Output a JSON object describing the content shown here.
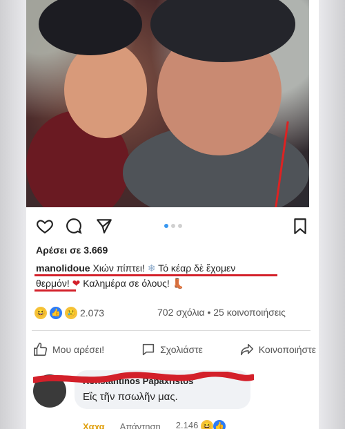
{
  "post": {
    "likes_text": "Αρέσει σε 3.669",
    "username": "manolidoue",
    "caption_part1": "Χιών πίπτει! ",
    "caption_part2": " Τό κέαρ δὲ ἔχομεν",
    "caption_part3": "θερμόν! ",
    "caption_part4": " Καλημέρα σε όλους! ",
    "snowflake_emoji": "❄",
    "heart_emoji": "❤",
    "boot_emoji": "👢"
  },
  "reactions": {
    "count": "2.073",
    "comments_shares": "702 σχόλια • 25 κοινοποιήσεις"
  },
  "fb_actions": {
    "like": "Μου αρέσει!",
    "comment": "Σχολιάστε",
    "share": "Κοινοποιήστε"
  },
  "comment": {
    "author": "Konstantinos Papaxristos",
    "text": "Εἲς τῆν πσωλῆν μας.",
    "haha": "Χαχα",
    "reply": "Απάντηση",
    "reaction_count": "2.146"
  },
  "icons": {
    "heart": "heart-outline-icon",
    "comment": "comment-bubble-icon",
    "send": "paper-plane-icon",
    "bookmark": "bookmark-icon"
  },
  "colors": {
    "accent_blue": "#3897f0",
    "annotation_red": "#d3202a",
    "fb_blue": "#2d7cf6"
  }
}
